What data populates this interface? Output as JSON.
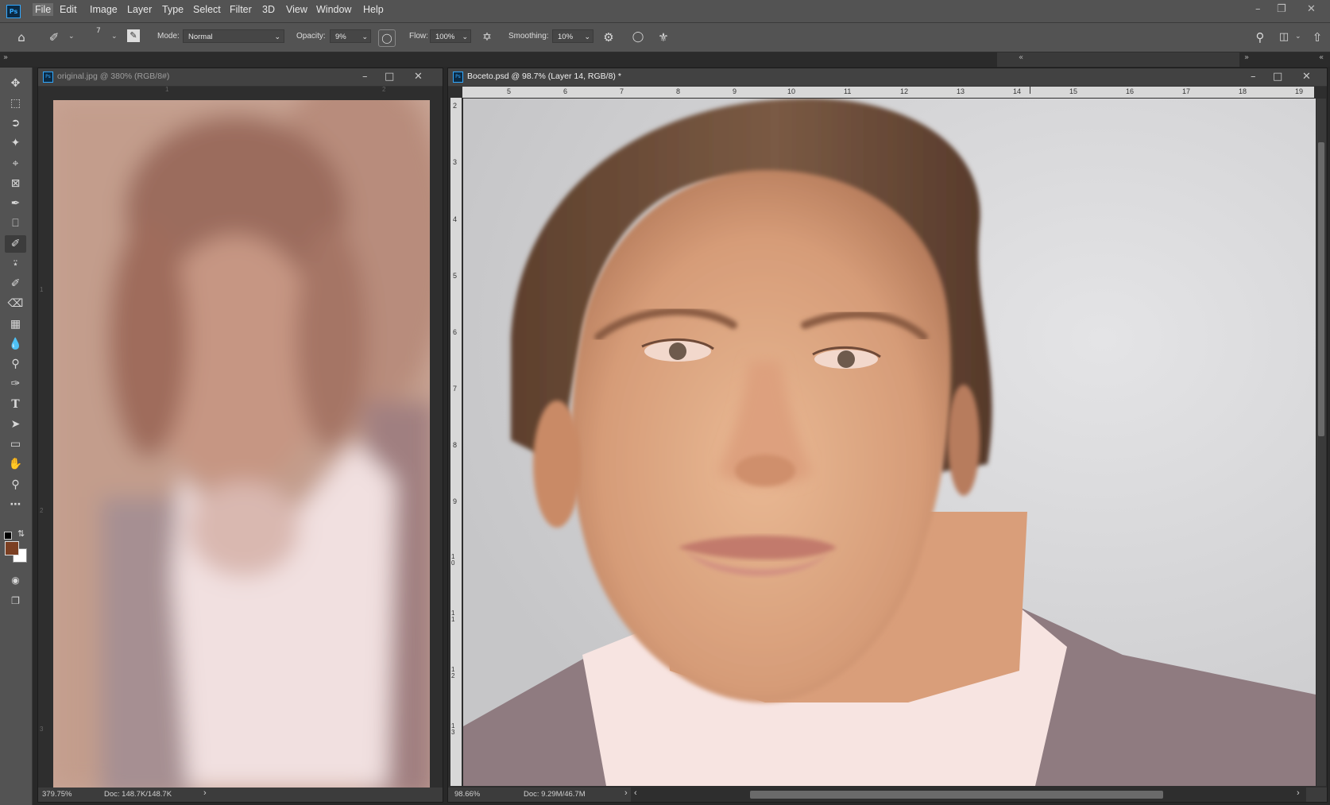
{
  "app_logo": "Ps",
  "menu": [
    "File",
    "Edit",
    "Image",
    "Layer",
    "Type",
    "Select",
    "Filter",
    "3D",
    "View",
    "Window",
    "Help"
  ],
  "options": {
    "brush_size": "7",
    "mode_label": "Mode:",
    "mode_value": "Normal",
    "opacity_label": "Opacity:",
    "opacity_value": "9%",
    "flow_label": "Flow:",
    "flow_value": "100%",
    "smoothing_label": "Smoothing:",
    "smoothing_value": "10%"
  },
  "doc_left": {
    "title": "original.jpg @ 380% (RGB/8#)",
    "zoom": "379.75%",
    "docsize": "Doc: 148.7K/148.7K",
    "ruler_top": [
      "1",
      "2"
    ],
    "ruler_left": [
      "1",
      "2",
      "3"
    ]
  },
  "doc_right": {
    "title": "Boceto.psd @ 98.7% (Layer 14, RGB/8) *",
    "zoom": "98.66%",
    "docsize": "Doc: 9.29M/46.7M",
    "ruler_top": [
      "5",
      "6",
      "7",
      "8",
      "9",
      "10",
      "11",
      "12",
      "13",
      "14",
      "15",
      "16",
      "17",
      "18",
      "19"
    ],
    "ruler_left": [
      "2",
      "3",
      "4",
      "5",
      "6",
      "7",
      "8",
      "9",
      "10",
      "11",
      "12",
      "13"
    ]
  },
  "colors": {
    "foreground": "#7b3f22",
    "background": "#ffffff",
    "accent": "#31a8ff"
  },
  "icons": {
    "tools": [
      "move-icon",
      "marquee-icon",
      "lasso-icon",
      "magic-wand-icon",
      "crop-icon",
      "frame-icon",
      "eyedropper-icon",
      "healing-icon",
      "brush-icon",
      "stamp-icon",
      "history-brush-icon",
      "eraser-icon",
      "gradient-icon",
      "blur-icon",
      "dodge-icon",
      "pen-icon",
      "type-icon",
      "path-select-icon",
      "rectangle-icon",
      "hand-icon",
      "zoom-icon",
      "more-icon"
    ]
  }
}
